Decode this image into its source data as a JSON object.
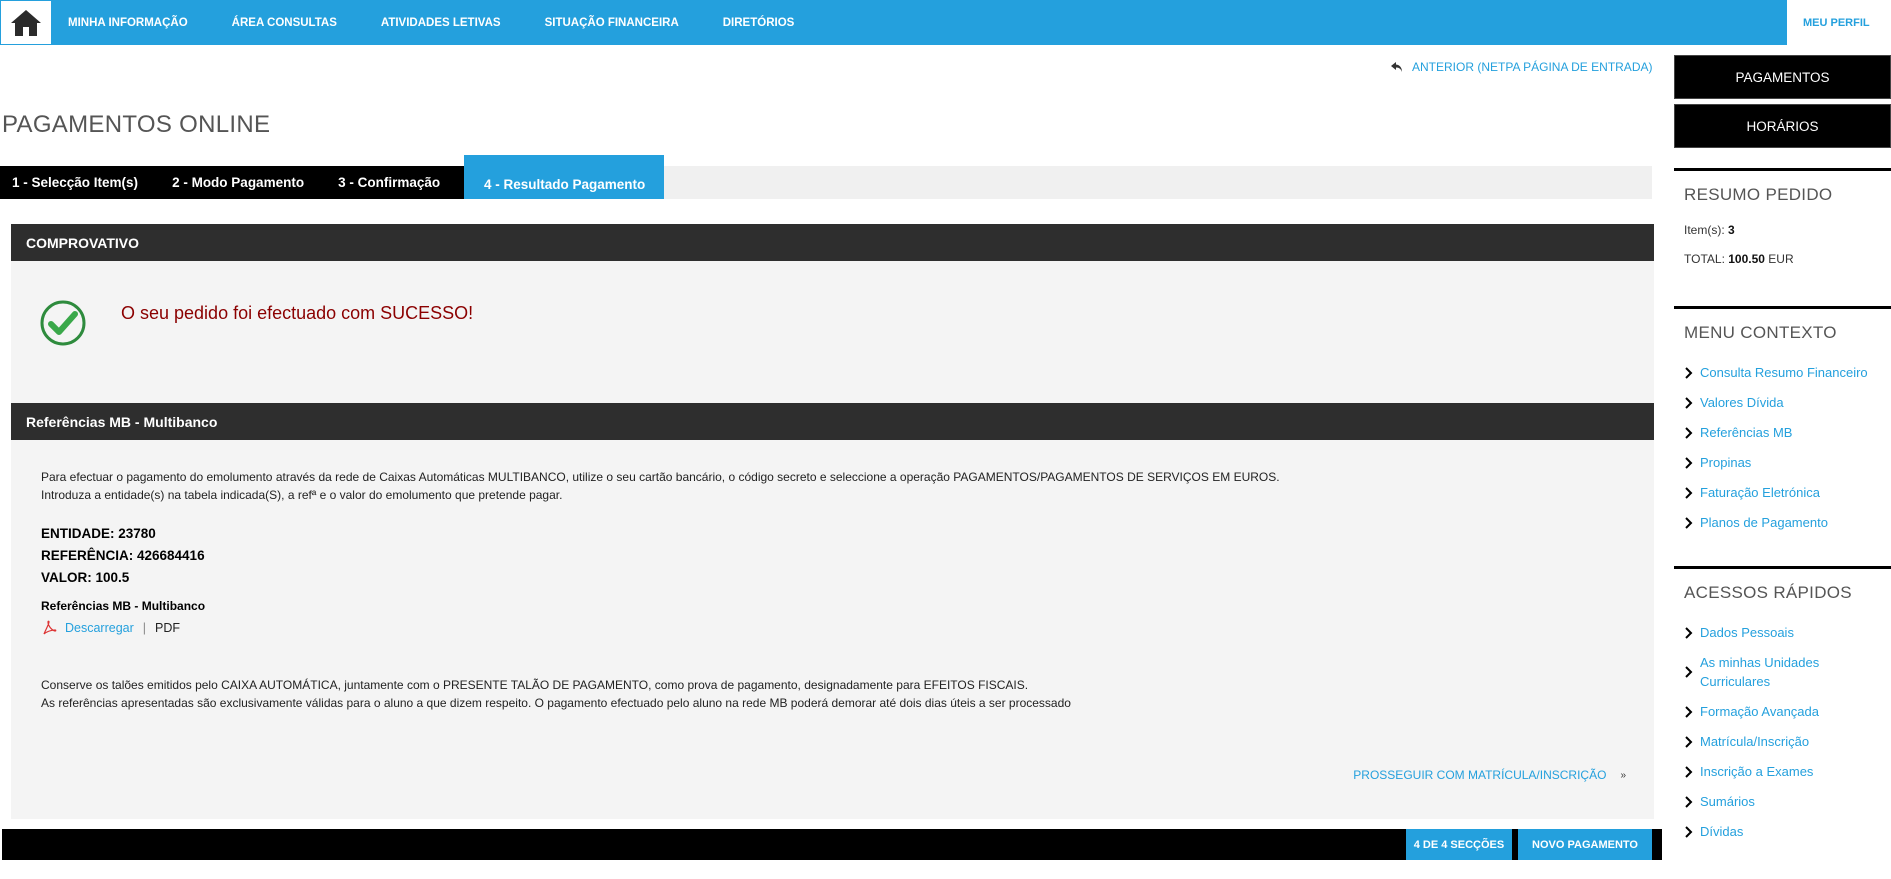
{
  "nav": {
    "items": [
      "MINHA INFORMAÇÃO",
      "ÁREA CONSULTAS",
      "ATIVIDADES LETIVAS",
      "SITUAÇÃO FINANCEIRA",
      "DIRETÓRIOS"
    ],
    "profile": "MEU PERFIL"
  },
  "back_link": "ANTERIOR (NETPA PÁGINA DE ENTRADA)",
  "page_title": "PAGAMENTOS ONLINE",
  "steps": {
    "step1": "1 - Selecção Item(s)",
    "step2": "2 - Modo Pagamento",
    "step3": "3 - Confirmação",
    "step4": "4 - Resultado Pagamento"
  },
  "receipt": {
    "header": "COMPROVATIVO",
    "success_message": "O seu pedido foi efectuado com SUCESSO!"
  },
  "mb": {
    "header": "Referências MB - Multibanco",
    "instruction_1": "Para efectuar o pagamento do emolumento através da rede de Caixas Automáticas MULTIBANCO, utilize o seu cartão bancário, o código secreto e seleccione a operação PAGAMENTOS/PAGAMENTOS DE SERVIÇOS EM EUROS.",
    "instruction_2": "Introduza a entidade(s) na tabela indicada(S), a refª e o valor do emolumento que pretende pagar.",
    "entidade": "ENTIDADE: 23780",
    "referencia": "REFERÊNCIA: 426684416",
    "valor": "VALOR: 100.5",
    "doc_title": "Referências MB - Multibanco",
    "download": "Descarregar",
    "format": "PDF",
    "note_1": "Conserve os talões emitidos pelo CAIXA AUTOMÁTICA, juntamente com o PRESENTE TALÃO DE PAGAMENTO, como prova de pagamento, designadamente para EFEITOS FISCAIS.",
    "note_2": "As referências apresentadas são exclusivamente válidas para o aluno a que dizem respeito. O pagamento efectuado pelo aluno na rede MB poderá demorar até dois dias úteis a ser processado",
    "proceed": "PROSSEGUIR COM MATRÍCULA/INSCRIÇÃO"
  },
  "footer": {
    "sections": "4 DE 4 SECÇÕES",
    "new_payment": "NOVO PAGAMENTO"
  },
  "sidebar": {
    "buttons": [
      "PAGAMENTOS",
      "HORÁRIOS"
    ],
    "summary": {
      "title": "RESUMO PEDIDO",
      "items_label": "Item(s):",
      "items_value": "3",
      "total_label": "TOTAL:",
      "total_value": "100.50",
      "currency": "EUR"
    },
    "context_menu": {
      "title": "MENU CONTEXTO",
      "links": [
        "Consulta Resumo Financeiro",
        "Valores Dívida",
        "Referências MB",
        "Propinas",
        "Faturação Eletrónica",
        "Planos de Pagamento"
      ]
    },
    "quick_access": {
      "title": "ACESSOS RÁPIDOS",
      "links": [
        "Dados Pessoais",
        "As minhas Unidades Curriculares",
        "Formação Avançada",
        "Matrícula/Inscrição",
        "Inscrição a Exames",
        "Sumários",
        "Dívidas"
      ]
    }
  },
  "colors": {
    "accent": "#24a0dd",
    "dark": "#2e2e2e",
    "success_text": "#8b0000",
    "success_icon": "#2e8b3d"
  }
}
